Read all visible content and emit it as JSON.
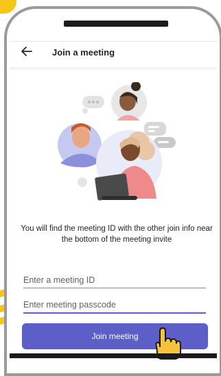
{
  "header": {
    "title": "Join a meeting",
    "back_icon": "arrow-left-icon"
  },
  "info_text": "You will find the meeting ID with the other join info near the bottom of the meeting invite",
  "form": {
    "meeting_id_placeholder": "Enter a meeting ID",
    "meeting_id_value": "",
    "passcode_placeholder": "Enter meeting passcode",
    "passcode_value": ""
  },
  "join_button": {
    "label": "Join meeting"
  },
  "colors": {
    "accent": "#5b5fc7",
    "highlight_yellow": "#f5c518",
    "frame_gray": "#9a9a9a"
  }
}
